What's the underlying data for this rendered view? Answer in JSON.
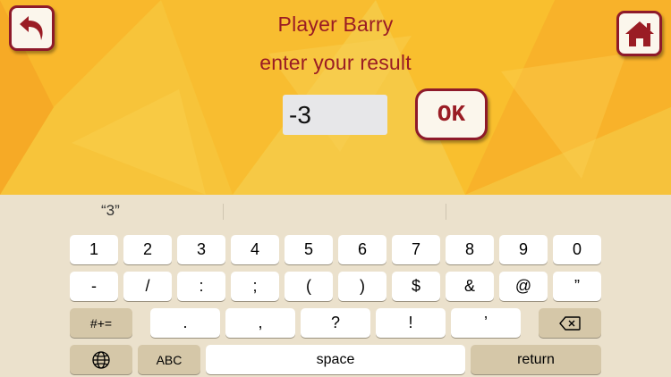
{
  "header": {
    "player_line": "Player Barry",
    "prompt_line": "enter your result"
  },
  "buttons": {
    "back_icon": "back-arrow-icon",
    "home_icon": "home-icon",
    "ok_label": "OK"
  },
  "result_input": {
    "value": "-3"
  },
  "keyboard": {
    "suggestions": [
      "“3”",
      "",
      ""
    ],
    "row1": [
      "1",
      "2",
      "3",
      "4",
      "5",
      "6",
      "7",
      "8",
      "9",
      "0"
    ],
    "row2": [
      "-",
      "/",
      ":",
      ";",
      "(",
      ")",
      "$",
      "&",
      "@",
      "”"
    ],
    "row3": {
      "mode_key": "#+=",
      "keys": [
        ".",
        ",",
        "?",
        "!",
        "’"
      ],
      "delete_icon": "backspace-icon"
    },
    "row4": {
      "globe_icon": "globe-icon",
      "abc_key": "ABC",
      "space_key": "space",
      "return_key": "return"
    }
  },
  "colors": {
    "background": "#f7c634",
    "accent": "#9a1c24",
    "button_fill": "#fbf6ec",
    "keyboard_bg": "#ebe1cc",
    "function_key": "#d5c7a8"
  }
}
